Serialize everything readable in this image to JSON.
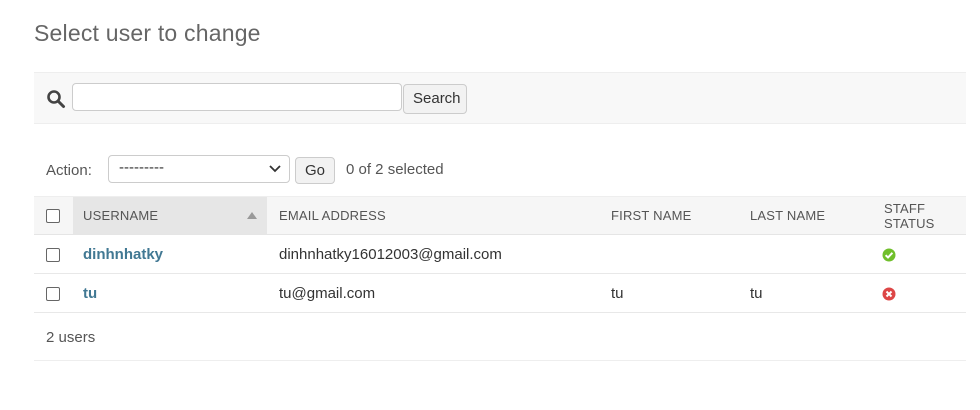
{
  "page_title": "Select user to change",
  "search": {
    "placeholder": "",
    "value": "",
    "button_label": "Search"
  },
  "actions": {
    "label": "Action:",
    "selected": "---------",
    "go_label": "Go",
    "selection_counter": "0 of 2 selected"
  },
  "table": {
    "columns": [
      "USERNAME",
      "EMAIL ADDRESS",
      "FIRST NAME",
      "LAST NAME",
      "STAFF STATUS"
    ],
    "rows": [
      {
        "username": "dinhnhatky",
        "email": "dinhnhatky16012003@gmail.com",
        "first_name": "",
        "last_name": "",
        "staff_status": "yes-icon"
      },
      {
        "username": "tu",
        "email": "tu@gmail.com",
        "first_name": "tu",
        "last_name": "tu",
        "staff_status": "no-icon"
      }
    ]
  },
  "result_count": "2 users",
  "colors": {
    "link": "#417893",
    "yes": "#70bf2b",
    "no": "#dd4646"
  }
}
